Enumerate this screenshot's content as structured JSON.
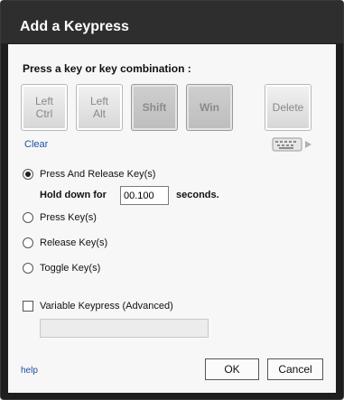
{
  "dialog": {
    "title": "Add a Keypress"
  },
  "prompt": "Press a key or key combination :",
  "keys": [
    {
      "label": "Left\nCtrl",
      "state": "normal"
    },
    {
      "label": "Left\nAlt",
      "state": "normal"
    },
    {
      "label": "Shift",
      "state": "pressed"
    },
    {
      "label": "Win",
      "state": "pressed"
    },
    {
      "label": "Delete",
      "state": "normal"
    }
  ],
  "clear_label": "Clear",
  "keyboard_icon": "keyboard-icon",
  "options": {
    "press_release": "Press And Release Key(s)",
    "hold_label": "Hold down for",
    "hold_value": "00.100",
    "seconds_label": "seconds.",
    "press": "Press Key(s)",
    "release": "Release Key(s)",
    "toggle": "Toggle Key(s)",
    "selected": "press_release"
  },
  "variable": {
    "label": "Variable Keypress (Advanced)",
    "checked": false,
    "value": ""
  },
  "footer": {
    "help": "help",
    "ok": "OK",
    "cancel": "Cancel"
  }
}
